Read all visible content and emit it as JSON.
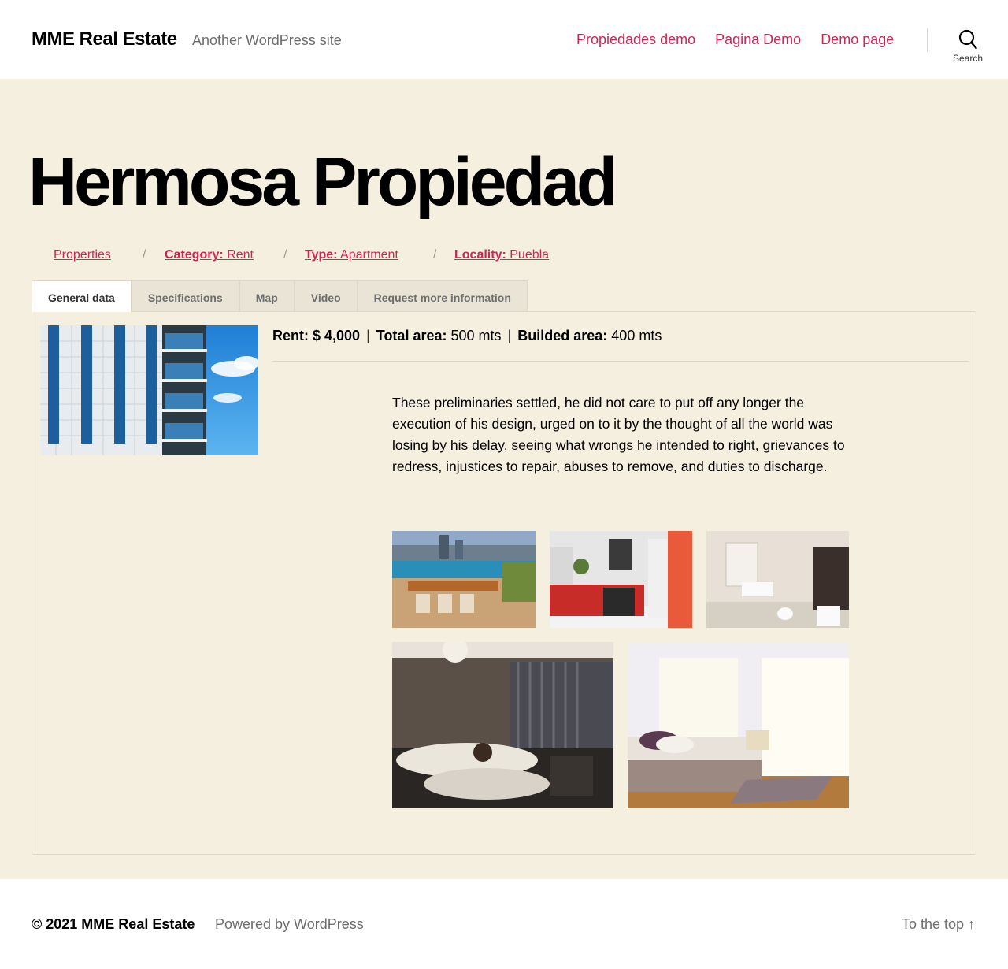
{
  "header": {
    "site_title": "MME Real Estate",
    "tagline": "Another WordPress site",
    "nav": [
      {
        "label": "Propiedades demo"
      },
      {
        "label": "Pagina Demo"
      },
      {
        "label": "Demo page"
      }
    ],
    "search_label": "Search"
  },
  "page": {
    "title": "Hermosa Propiedad",
    "breadcrumb": {
      "properties": "Properties",
      "category_label": "Category:",
      "category_value": "Rent",
      "type_label": "Type:",
      "type_value": "Apartment",
      "locality_label": "Locality:",
      "locality_value": "Puebla",
      "separator": "/"
    },
    "tabs": [
      {
        "label": "General data",
        "active": true
      },
      {
        "label": "Specifications"
      },
      {
        "label": "Map"
      },
      {
        "label": "Video"
      },
      {
        "label": "Request more information"
      }
    ],
    "facts": {
      "rent_label": "Rent: $ 4,000",
      "total_area_label": "Total area:",
      "total_area_value": "500 mts",
      "builded_area_label": "Builded area:",
      "builded_area_value": "400 mts",
      "separator": "|"
    },
    "description": "These preliminaries settled, he did not care to put off any longer the execution of his design, urged on to it by the thought of all the world was losing by his delay, seeing what wrongs he intended to right, grievances to redress, injustices to repair, abuses to remove, and duties to discharge."
  },
  "footer": {
    "copyright": "© 2021 MME Real Estate",
    "powered": "Powered by WordPress",
    "to_top": "To the top ↑"
  },
  "colors": {
    "accent": "#cd2653",
    "background": "#f5efe0",
    "muted": "#6d6d6d"
  }
}
